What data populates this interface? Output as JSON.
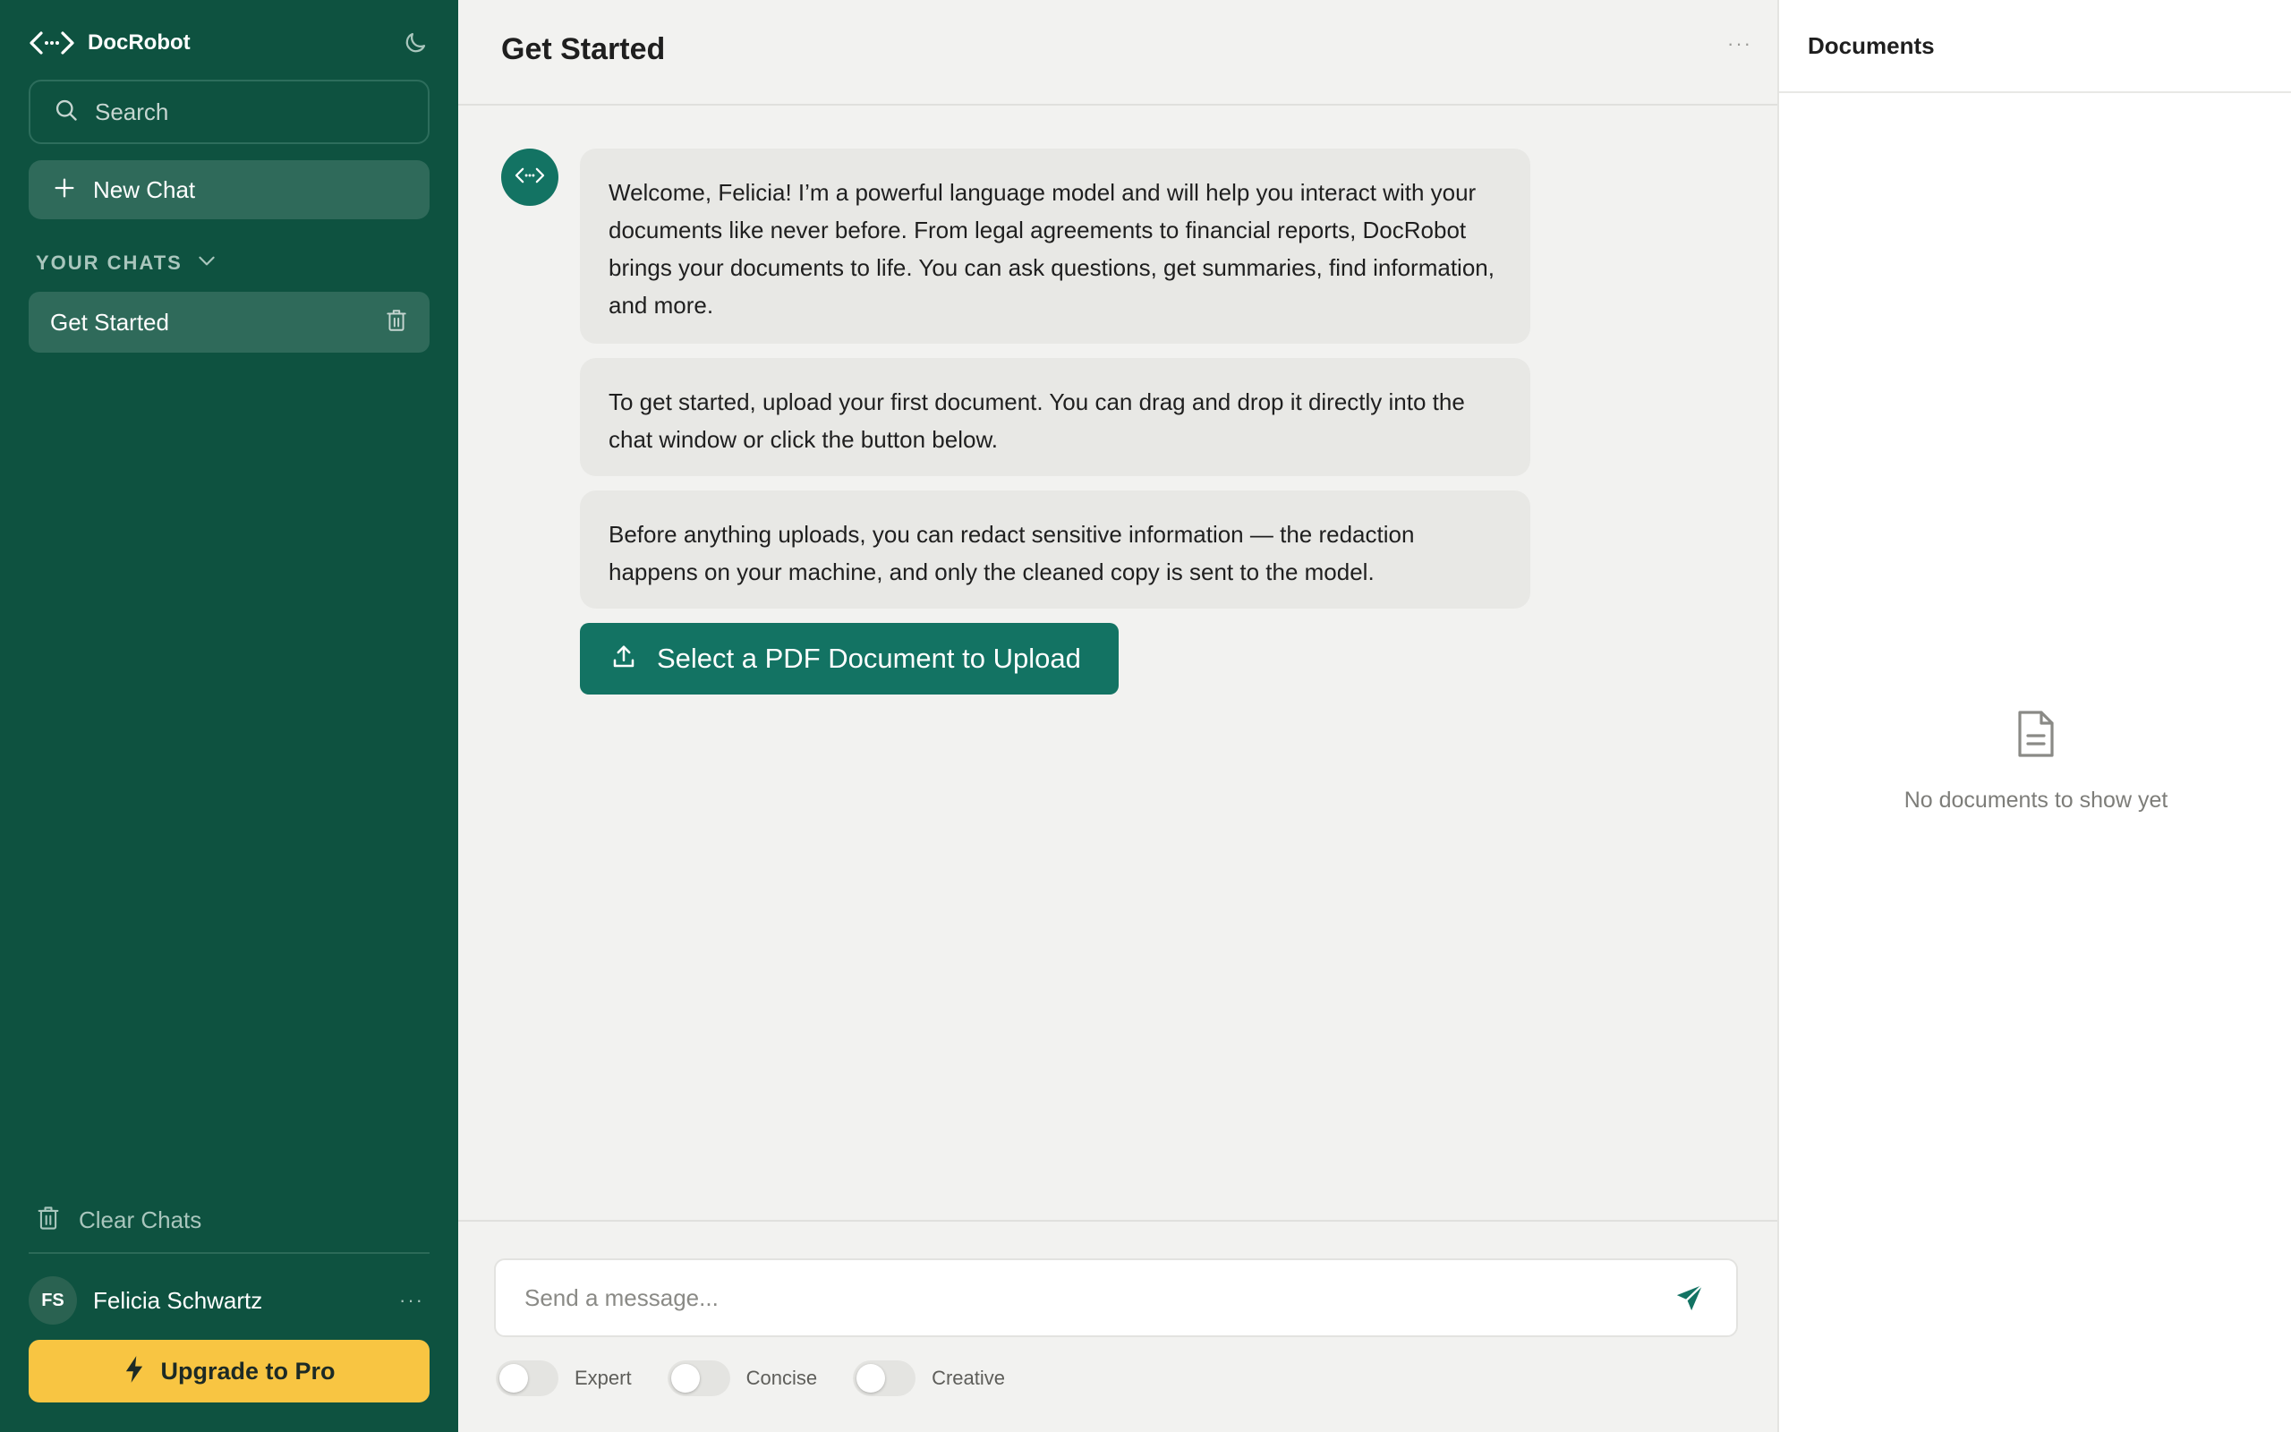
{
  "app": {
    "name": "DocRobot",
    "accent": "#137363",
    "sidebar_bg": "#0e5240",
    "upgrade_bg": "#f8c542"
  },
  "sidebar": {
    "search_placeholder": "Search",
    "new_chat_label": "New Chat",
    "chats_header": "YOUR CHATS",
    "chats": [
      {
        "label": "Get Started"
      }
    ],
    "clear_chats_label": "Clear Chats",
    "user": {
      "initials": "FS",
      "name": "Felicia Schwartz"
    },
    "more_label": "···",
    "upgrade_label": "Upgrade to Pro"
  },
  "main": {
    "title": "Get Started",
    "more_label": "···",
    "messages": [
      "Welcome, Felicia! I’m a powerful language model and will help you interact with your documents like never before. From legal agreements to financial reports, DocRobot brings your documents to life. You can ask questions, get summaries, find information, and more.",
      "To get started, upload your first document. You can drag and drop it directly into the chat window or click the button below.",
      "Before anything uploads, you can redact sensitive information — the redaction happens on your machine, and only the cleaned copy is sent to the model."
    ],
    "upload_label": "Select a PDF Document to Upload",
    "composer_placeholder": "Send a message...",
    "toggles": [
      {
        "label": "Expert",
        "on": false
      },
      {
        "label": "Concise",
        "on": false
      },
      {
        "label": "Creative",
        "on": false
      }
    ]
  },
  "documents": {
    "title": "Documents",
    "empty_text": "No documents to show yet"
  }
}
